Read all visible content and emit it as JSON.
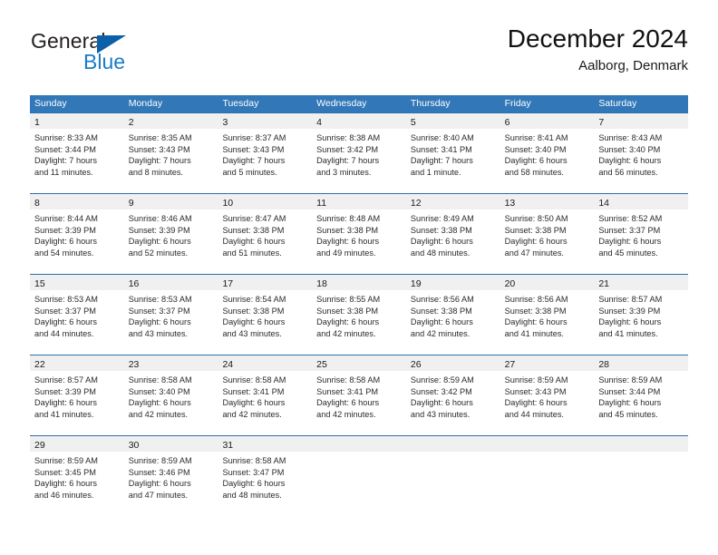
{
  "brand": {
    "name_part1": "General",
    "name_part2": "Blue",
    "triangle_color": "#0c60a8",
    "blue_text_color": "#1b7bc4"
  },
  "header": {
    "title": "December 2024",
    "subtitle": "Aalborg, Denmark",
    "accent_color": "#3278b8",
    "band_color": "#f0f0f0"
  },
  "calendar": {
    "weekday_headers": [
      "Sunday",
      "Monday",
      "Tuesday",
      "Wednesday",
      "Thursday",
      "Friday",
      "Saturday"
    ],
    "weeks": [
      [
        {
          "day": "1",
          "sunrise": "Sunrise: 8:33 AM",
          "sunset": "Sunset: 3:44 PM",
          "daylight_line1": "Daylight: 7 hours",
          "daylight_line2": "and 11 minutes."
        },
        {
          "day": "2",
          "sunrise": "Sunrise: 8:35 AM",
          "sunset": "Sunset: 3:43 PM",
          "daylight_line1": "Daylight: 7 hours",
          "daylight_line2": "and 8 minutes."
        },
        {
          "day": "3",
          "sunrise": "Sunrise: 8:37 AM",
          "sunset": "Sunset: 3:43 PM",
          "daylight_line1": "Daylight: 7 hours",
          "daylight_line2": "and 5 minutes."
        },
        {
          "day": "4",
          "sunrise": "Sunrise: 8:38 AM",
          "sunset": "Sunset: 3:42 PM",
          "daylight_line1": "Daylight: 7 hours",
          "daylight_line2": "and 3 minutes."
        },
        {
          "day": "5",
          "sunrise": "Sunrise: 8:40 AM",
          "sunset": "Sunset: 3:41 PM",
          "daylight_line1": "Daylight: 7 hours",
          "daylight_line2": "and 1 minute."
        },
        {
          "day": "6",
          "sunrise": "Sunrise: 8:41 AM",
          "sunset": "Sunset: 3:40 PM",
          "daylight_line1": "Daylight: 6 hours",
          "daylight_line2": "and 58 minutes."
        },
        {
          "day": "7",
          "sunrise": "Sunrise: 8:43 AM",
          "sunset": "Sunset: 3:40 PM",
          "daylight_line1": "Daylight: 6 hours",
          "daylight_line2": "and 56 minutes."
        }
      ],
      [
        {
          "day": "8",
          "sunrise": "Sunrise: 8:44 AM",
          "sunset": "Sunset: 3:39 PM",
          "daylight_line1": "Daylight: 6 hours",
          "daylight_line2": "and 54 minutes."
        },
        {
          "day": "9",
          "sunrise": "Sunrise: 8:46 AM",
          "sunset": "Sunset: 3:39 PM",
          "daylight_line1": "Daylight: 6 hours",
          "daylight_line2": "and 52 minutes."
        },
        {
          "day": "10",
          "sunrise": "Sunrise: 8:47 AM",
          "sunset": "Sunset: 3:38 PM",
          "daylight_line1": "Daylight: 6 hours",
          "daylight_line2": "and 51 minutes."
        },
        {
          "day": "11",
          "sunrise": "Sunrise: 8:48 AM",
          "sunset": "Sunset: 3:38 PM",
          "daylight_line1": "Daylight: 6 hours",
          "daylight_line2": "and 49 minutes."
        },
        {
          "day": "12",
          "sunrise": "Sunrise: 8:49 AM",
          "sunset": "Sunset: 3:38 PM",
          "daylight_line1": "Daylight: 6 hours",
          "daylight_line2": "and 48 minutes."
        },
        {
          "day": "13",
          "sunrise": "Sunrise: 8:50 AM",
          "sunset": "Sunset: 3:38 PM",
          "daylight_line1": "Daylight: 6 hours",
          "daylight_line2": "and 47 minutes."
        },
        {
          "day": "14",
          "sunrise": "Sunrise: 8:52 AM",
          "sunset": "Sunset: 3:37 PM",
          "daylight_line1": "Daylight: 6 hours",
          "daylight_line2": "and 45 minutes."
        }
      ],
      [
        {
          "day": "15",
          "sunrise": "Sunrise: 8:53 AM",
          "sunset": "Sunset: 3:37 PM",
          "daylight_line1": "Daylight: 6 hours",
          "daylight_line2": "and 44 minutes."
        },
        {
          "day": "16",
          "sunrise": "Sunrise: 8:53 AM",
          "sunset": "Sunset: 3:37 PM",
          "daylight_line1": "Daylight: 6 hours",
          "daylight_line2": "and 43 minutes."
        },
        {
          "day": "17",
          "sunrise": "Sunrise: 8:54 AM",
          "sunset": "Sunset: 3:38 PM",
          "daylight_line1": "Daylight: 6 hours",
          "daylight_line2": "and 43 minutes."
        },
        {
          "day": "18",
          "sunrise": "Sunrise: 8:55 AM",
          "sunset": "Sunset: 3:38 PM",
          "daylight_line1": "Daylight: 6 hours",
          "daylight_line2": "and 42 minutes."
        },
        {
          "day": "19",
          "sunrise": "Sunrise: 8:56 AM",
          "sunset": "Sunset: 3:38 PM",
          "daylight_line1": "Daylight: 6 hours",
          "daylight_line2": "and 42 minutes."
        },
        {
          "day": "20",
          "sunrise": "Sunrise: 8:56 AM",
          "sunset": "Sunset: 3:38 PM",
          "daylight_line1": "Daylight: 6 hours",
          "daylight_line2": "and 41 minutes."
        },
        {
          "day": "21",
          "sunrise": "Sunrise: 8:57 AM",
          "sunset": "Sunset: 3:39 PM",
          "daylight_line1": "Daylight: 6 hours",
          "daylight_line2": "and 41 minutes."
        }
      ],
      [
        {
          "day": "22",
          "sunrise": "Sunrise: 8:57 AM",
          "sunset": "Sunset: 3:39 PM",
          "daylight_line1": "Daylight: 6 hours",
          "daylight_line2": "and 41 minutes."
        },
        {
          "day": "23",
          "sunrise": "Sunrise: 8:58 AM",
          "sunset": "Sunset: 3:40 PM",
          "daylight_line1": "Daylight: 6 hours",
          "daylight_line2": "and 42 minutes."
        },
        {
          "day": "24",
          "sunrise": "Sunrise: 8:58 AM",
          "sunset": "Sunset: 3:41 PM",
          "daylight_line1": "Daylight: 6 hours",
          "daylight_line2": "and 42 minutes."
        },
        {
          "day": "25",
          "sunrise": "Sunrise: 8:58 AM",
          "sunset": "Sunset: 3:41 PM",
          "daylight_line1": "Daylight: 6 hours",
          "daylight_line2": "and 42 minutes."
        },
        {
          "day": "26",
          "sunrise": "Sunrise: 8:59 AM",
          "sunset": "Sunset: 3:42 PM",
          "daylight_line1": "Daylight: 6 hours",
          "daylight_line2": "and 43 minutes."
        },
        {
          "day": "27",
          "sunrise": "Sunrise: 8:59 AM",
          "sunset": "Sunset: 3:43 PM",
          "daylight_line1": "Daylight: 6 hours",
          "daylight_line2": "and 44 minutes."
        },
        {
          "day": "28",
          "sunrise": "Sunrise: 8:59 AM",
          "sunset": "Sunset: 3:44 PM",
          "daylight_line1": "Daylight: 6 hours",
          "daylight_line2": "and 45 minutes."
        }
      ],
      [
        {
          "day": "29",
          "sunrise": "Sunrise: 8:59 AM",
          "sunset": "Sunset: 3:45 PM",
          "daylight_line1": "Daylight: 6 hours",
          "daylight_line2": "and 46 minutes."
        },
        {
          "day": "30",
          "sunrise": "Sunrise: 8:59 AM",
          "sunset": "Sunset: 3:46 PM",
          "daylight_line1": "Daylight: 6 hours",
          "daylight_line2": "and 47 minutes."
        },
        {
          "day": "31",
          "sunrise": "Sunrise: 8:58 AM",
          "sunset": "Sunset: 3:47 PM",
          "daylight_line1": "Daylight: 6 hours",
          "daylight_line2": "and 48 minutes."
        },
        {
          "day": "",
          "sunrise": "",
          "sunset": "",
          "daylight_line1": "",
          "daylight_line2": ""
        },
        {
          "day": "",
          "sunrise": "",
          "sunset": "",
          "daylight_line1": "",
          "daylight_line2": ""
        },
        {
          "day": "",
          "sunrise": "",
          "sunset": "",
          "daylight_line1": "",
          "daylight_line2": ""
        },
        {
          "day": "",
          "sunrise": "",
          "sunset": "",
          "daylight_line1": "",
          "daylight_line2": ""
        }
      ]
    ]
  }
}
